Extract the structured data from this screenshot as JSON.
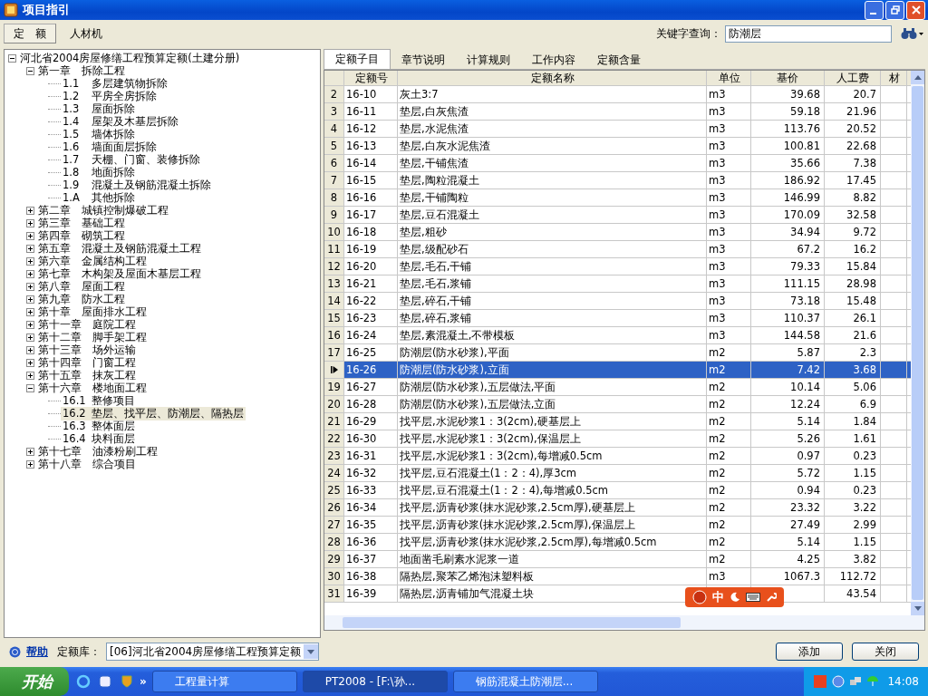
{
  "window": {
    "title": "项目指引"
  },
  "mode_tabs": [
    {
      "label": "定　额",
      "selected": true
    },
    {
      "label": "人材机",
      "selected": false
    }
  ],
  "search": {
    "label": "关键字查询：",
    "value": "防潮层"
  },
  "tree": [
    {
      "label": "河北省2004房屋修缮工程预算定额(土建分册)",
      "expanded": true,
      "children": [
        {
          "number": "第一章",
          "title": "拆除工程",
          "expanded": true,
          "children": [
            {
              "number": "1.1",
              "title": "多层建筑物拆除",
              "selected": false
            },
            {
              "number": "1.2",
              "title": "平房全房拆除",
              "selected": false
            },
            {
              "number": "1.3",
              "title": "屋面拆除",
              "selected": false
            },
            {
              "number": "1.4",
              "title": "屋架及木基层拆除",
              "selected": false
            },
            {
              "number": "1.5",
              "title": "墙体拆除",
              "selected": false
            },
            {
              "number": "1.6",
              "title": "墙面面层拆除",
              "selected": false
            },
            {
              "number": "1.7",
              "title": "天棚、门窗、装修拆除",
              "selected": false
            },
            {
              "number": "1.8",
              "title": "地面拆除",
              "selected": false
            },
            {
              "number": "1.9",
              "title": "混凝土及钢筋混凝土拆除",
              "selected": false
            },
            {
              "number": "1.A",
              "title": "其他拆除",
              "selected": false
            }
          ]
        },
        {
          "number": "第二章",
          "title": "城镇控制爆破工程",
          "expanded": false
        },
        {
          "number": "第三章",
          "title": "基础工程",
          "expanded": false
        },
        {
          "number": "第四章",
          "title": "砌筑工程",
          "expanded": false
        },
        {
          "number": "第五章",
          "title": "混凝土及钢筋混凝土工程",
          "expanded": false
        },
        {
          "number": "第六章",
          "title": "金属结构工程",
          "expanded": false
        },
        {
          "number": "第七章",
          "title": "木构架及屋面木基层工程",
          "expanded": false
        },
        {
          "number": "第八章",
          "title": "屋面工程",
          "expanded": false
        },
        {
          "number": "第九章",
          "title": "防水工程",
          "expanded": false
        },
        {
          "number": "第十章",
          "title": "屋面排水工程",
          "expanded": false
        },
        {
          "number": "第十一章",
          "title": "庭院工程",
          "expanded": false
        },
        {
          "number": "第十二章",
          "title": "脚手架工程",
          "expanded": false
        },
        {
          "number": "第十三章",
          "title": "场外运输",
          "expanded": false
        },
        {
          "number": "第十四章",
          "title": "门窗工程",
          "expanded": false
        },
        {
          "number": "第十五章",
          "title": "抹灰工程",
          "expanded": false
        },
        {
          "number": "第十六章",
          "title": "楼地面工程",
          "expanded": true,
          "children": [
            {
              "number": "16.1",
              "title": "整修项目",
              "selected": false
            },
            {
              "number": "16.2",
              "title": "垫层、找平层、防潮层、隔热层",
              "selected": true
            },
            {
              "number": "16.3",
              "title": "整体面层",
              "selected": false
            },
            {
              "number": "16.4",
              "title": "块料面层",
              "selected": false
            }
          ]
        },
        {
          "number": "第十七章",
          "title": "油漆粉刷工程",
          "expanded": false
        },
        {
          "number": "第十八章",
          "title": "综合项目",
          "expanded": false
        }
      ]
    }
  ],
  "tabs": [
    {
      "label": "定额子目",
      "selected": true
    },
    {
      "label": "章节说明",
      "selected": false
    },
    {
      "label": "计算规则",
      "selected": false
    },
    {
      "label": "工作内容",
      "selected": false
    },
    {
      "label": "定额含量",
      "selected": false
    }
  ],
  "table": {
    "columns": [
      "定额号",
      "定额名称",
      "单位",
      "基价",
      "人工费",
      "材"
    ],
    "rows": [
      {
        "num": "2",
        "code": "16-10",
        "name": "灰土3:7",
        "unit": "m3",
        "price": "39.68",
        "labor": "20.7",
        "selected": false
      },
      {
        "num": "3",
        "code": "16-11",
        "name": "垫层,白灰焦渣",
        "unit": "m3",
        "price": "59.18",
        "labor": "21.96",
        "selected": false
      },
      {
        "num": "4",
        "code": "16-12",
        "name": "垫层,水泥焦渣",
        "unit": "m3",
        "price": "113.76",
        "labor": "20.52",
        "selected": false
      },
      {
        "num": "5",
        "code": "16-13",
        "name": "垫层,白灰水泥焦渣",
        "unit": "m3",
        "price": "100.81",
        "labor": "22.68",
        "selected": false
      },
      {
        "num": "6",
        "code": "16-14",
        "name": "垫层,干铺焦渣",
        "unit": "m3",
        "price": "35.66",
        "labor": "7.38",
        "selected": false
      },
      {
        "num": "7",
        "code": "16-15",
        "name": "垫层,陶粒混凝土",
        "unit": "m3",
        "price": "186.92",
        "labor": "17.45",
        "selected": false
      },
      {
        "num": "8",
        "code": "16-16",
        "name": "垫层,干铺陶粒",
        "unit": "m3",
        "price": "146.99",
        "labor": "8.82",
        "selected": false
      },
      {
        "num": "9",
        "code": "16-17",
        "name": "垫层,豆石混凝土",
        "unit": "m3",
        "price": "170.09",
        "labor": "32.58",
        "selected": false
      },
      {
        "num": "10",
        "code": "16-18",
        "name": "垫层,粗砂",
        "unit": "m3",
        "price": "34.94",
        "labor": "9.72",
        "selected": false
      },
      {
        "num": "11",
        "code": "16-19",
        "name": "垫层,级配砂石",
        "unit": "m3",
        "price": "67.2",
        "labor": "16.2",
        "selected": false
      },
      {
        "num": "12",
        "code": "16-20",
        "name": "垫层,毛石,干铺",
        "unit": "m3",
        "price": "79.33",
        "labor": "15.84",
        "selected": false
      },
      {
        "num": "13",
        "code": "16-21",
        "name": "垫层,毛石,浆铺",
        "unit": "m3",
        "price": "111.15",
        "labor": "28.98",
        "selected": false
      },
      {
        "num": "14",
        "code": "16-22",
        "name": "垫层,碎石,干铺",
        "unit": "m3",
        "price": "73.18",
        "labor": "15.48",
        "selected": false
      },
      {
        "num": "15",
        "code": "16-23",
        "name": "垫层,碎石,浆铺",
        "unit": "m3",
        "price": "110.37",
        "labor": "26.1",
        "selected": false
      },
      {
        "num": "16",
        "code": "16-24",
        "name": "垫层,素混凝土,不带模板",
        "unit": "m3",
        "price": "144.58",
        "labor": "21.6",
        "selected": false
      },
      {
        "num": "17",
        "code": "16-25",
        "name": "防潮层(防水砂浆),平面",
        "unit": "m2",
        "price": "5.87",
        "labor": "2.3",
        "selected": false
      },
      {
        "code": "16-26",
        "name": "防潮层(防水砂浆),立面",
        "unit": "m2",
        "price": "7.42",
        "labor": "3.68",
        "selected": true
      },
      {
        "num": "19",
        "code": "16-27",
        "name": "防潮层(防水砂浆),五层做法,平面",
        "unit": "m2",
        "price": "10.14",
        "labor": "5.06",
        "selected": false
      },
      {
        "num": "20",
        "code": "16-28",
        "name": "防潮层(防水砂浆),五层做法,立面",
        "unit": "m2",
        "price": "12.24",
        "labor": "6.9",
        "selected": false
      },
      {
        "num": "21",
        "code": "16-29",
        "name": "找平层,水泥砂浆1：3(2cm),硬基层上",
        "unit": "m2",
        "price": "5.14",
        "labor": "1.84",
        "selected": false
      },
      {
        "num": "22",
        "code": "16-30",
        "name": "找平层,水泥砂浆1：3(2cm),保温层上",
        "unit": "m2",
        "price": "5.26",
        "labor": "1.61",
        "selected": false
      },
      {
        "num": "23",
        "code": "16-31",
        "name": "找平层,水泥砂浆1：3(2cm),每增减0.5cm",
        "unit": "m2",
        "price": "0.97",
        "labor": "0.23",
        "selected": false
      },
      {
        "num": "24",
        "code": "16-32",
        "name": "找平层,豆石混凝土(1：2：4),厚3cm",
        "unit": "m2",
        "price": "5.72",
        "labor": "1.15",
        "selected": false
      },
      {
        "num": "25",
        "code": "16-33",
        "name": "找平层,豆石混凝土(1：2：4),每增减0.5cm",
        "unit": "m2",
        "price": "0.94",
        "labor": "0.23",
        "selected": false
      },
      {
        "num": "26",
        "code": "16-34",
        "name": "找平层,沥青砂浆(抹水泥砂浆,2.5cm厚),硬基层上",
        "unit": "m2",
        "price": "23.32",
        "labor": "3.22",
        "selected": false
      },
      {
        "num": "27",
        "code": "16-35",
        "name": "找平层,沥青砂浆(抹水泥砂浆,2.5cm厚),保温层上",
        "unit": "m2",
        "price": "27.49",
        "labor": "2.99",
        "selected": false
      },
      {
        "num": "28",
        "code": "16-36",
        "name": "找平层,沥青砂浆(抹水泥砂浆,2.5cm厚),每增减0.5cm",
        "unit": "m2",
        "price": "5.14",
        "labor": "1.15",
        "selected": false
      },
      {
        "num": "29",
        "code": "16-37",
        "name": "地面凿毛刷素水泥浆一道",
        "unit": "m2",
        "price": "4.25",
        "labor": "3.82",
        "selected": false
      },
      {
        "num": "30",
        "code": "16-38",
        "name": "隔热层,聚苯乙烯泡沫塑料板",
        "unit": "m3",
        "price": "1067.3",
        "labor": "112.72",
        "selected": false
      },
      {
        "num": "31",
        "code": "16-39",
        "name": "隔热层,沥青铺加气混凝土块",
        "labor": "43.54",
        "selected": false
      }
    ]
  },
  "ime_bar": {
    "label": "中"
  },
  "footer": {
    "help": "帮助",
    "library_label": "定额库：",
    "library_value": "[06]河北省2004房屋修缮工程预算定额",
    "buttons": [
      "添加",
      "关闭"
    ]
  },
  "taskbar": {
    "start": "开始",
    "more": "»",
    "tasks": [
      {
        "label": "工程量计算",
        "selected": false
      },
      {
        "label": "PT2008 - [F:\\孙...",
        "selected": true
      },
      {
        "label": "钢筋混凝土防潮层...",
        "selected": false
      }
    ],
    "time": "14:08"
  }
}
